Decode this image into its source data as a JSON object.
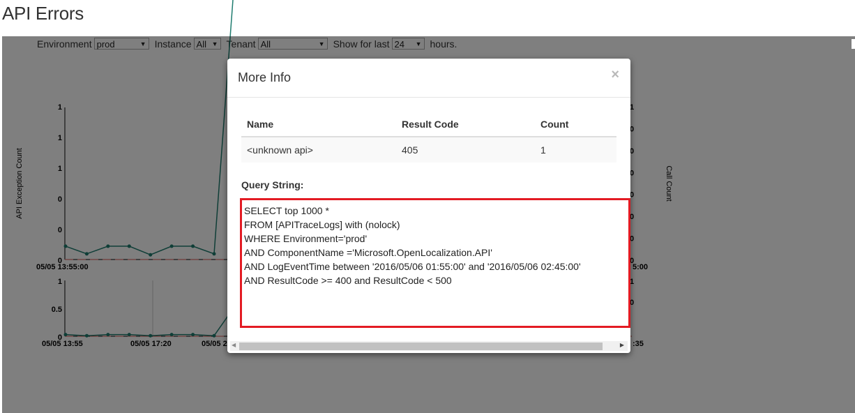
{
  "page": {
    "title": "API Errors"
  },
  "filters": {
    "environment_label": "Environment",
    "environment_value": "prod",
    "instance_label": "Instance",
    "instance_value": "All",
    "tenant_label": "Tenant",
    "tenant_value": "All",
    "show_label": "Show for last",
    "hours_value": "24",
    "hours_suffix": "hours."
  },
  "chart_data": [
    {
      "type": "line",
      "ylabel": "API Exception Count",
      "y2label": "Call Count",
      "y_ticks": [
        "1",
        "1",
        "1",
        "0",
        "0",
        "0"
      ],
      "x_start_label": "05/05 13:55:00",
      "x_end_label": "5:00",
      "right_ticks": [
        "1",
        "0",
        "0",
        "0",
        "0",
        "0",
        "0",
        "0"
      ],
      "series": [
        {
          "values": [
            0.14,
            0.06,
            0.14,
            0.14,
            0.05,
            0.14,
            0.14,
            0.06,
            3.1
          ]
        }
      ]
    },
    {
      "type": "line",
      "y_ticks": [
        "1",
        "0.5",
        "0"
      ],
      "x_labels": [
        "05/05 13:55",
        "05/05 17:20",
        "05/05 2"
      ],
      "x_end_label": ":35",
      "right_ticks": [
        "1",
        "0"
      ],
      "series": [
        {
          "values": [
            0.03,
            0.01,
            0.03,
            0.03,
            0.01,
            0.03,
            0.03,
            0.01,
            0.55
          ]
        }
      ]
    }
  ],
  "modal": {
    "title": "More Info",
    "close": "×",
    "table": {
      "headers": [
        "Name",
        "Result Code",
        "Count"
      ],
      "rows": [
        [
          "<unknown api>",
          "405",
          "1"
        ]
      ]
    },
    "query_label": "Query String:",
    "query_lines": [
      "SELECT top 1000 *",
      "FROM [APITraceLogs] with (nolock)",
      "WHERE Environment='prod'",
      "AND ComponentName ='Microsoft.OpenLocalization.API'",
      "AND LogEventTime between '2016/05/06 01:55:00' and '2016/05/06 02:45:00'",
      "AND ResultCode >= 400 and ResultCode < 500"
    ]
  },
  "icons": {
    "dropdown": "chevron-down-icon",
    "scroll_left": "scroll-left-icon",
    "scroll_right": "scroll-right-icon"
  },
  "colors": {
    "series": "#1f7c6f",
    "highlight_border": "#e31b23",
    "baseline": "#d9534f"
  }
}
